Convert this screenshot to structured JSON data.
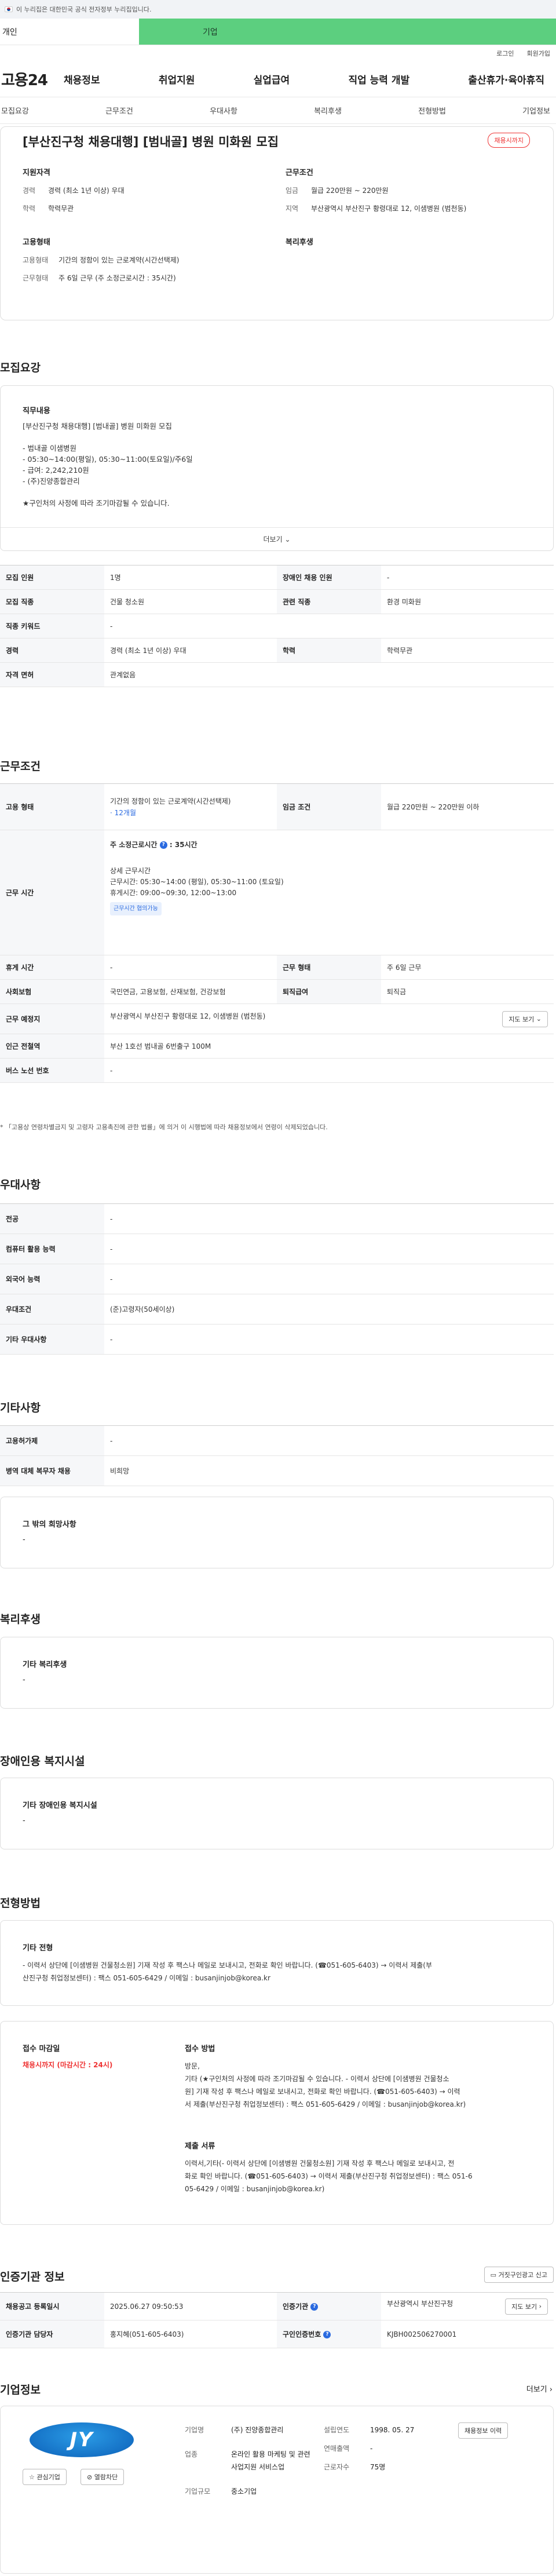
{
  "gov_notice": "이 누리집은 대한민국 공식 전자정부 누리집입니다.",
  "tabs": {
    "personal": "개인",
    "company": "기업"
  },
  "util": {
    "login": "로그인",
    "join": "회원가입"
  },
  "logo": "고용24",
  "gnb": [
    "채용정보",
    "취업지원",
    "실업급여",
    "직업 능력 개발",
    "출산휴가·육아휴직"
  ],
  "subnav": [
    "모집요강",
    "근무조건",
    "우대사항",
    "복리후생",
    "전형방법",
    "기업정보"
  ],
  "job": {
    "title": "[부산진구청 채용대행] [범내골] 병원 미화원 모집",
    "badge": "채용시까지",
    "applicant_title": "지원자격",
    "career_label": "경력",
    "career_value": "경력 (최소 1년 이상) 우대",
    "edu_label": "학력",
    "edu_value": "학력무관",
    "work_title": "근무조건",
    "wage_label": "임금",
    "wage_value": "월급 220만원 ~ 220만원",
    "region_label": "지역",
    "region_value": "부산광역시 부산진구 황령대로 12, 이샘병원 (범천동)",
    "emp_title": "고용형태",
    "emp_label": "고용형태",
    "emp_value": "기간의 정함이 있는 근로계약(시간선택제)",
    "hours_label": "근무형태",
    "hours_value": "주 6일 근무 (주 소정근로시간 : 35시간)",
    "welfare_title": "복리후생"
  },
  "recruit": {
    "section_title": "모집요강",
    "duty_title": "직무내용",
    "duty_lines": [
      "[부산진구청 채용대행] [범내골] 병원 미화원 모집",
      "",
      "- 범내골 이샘병원",
      "- 05:30~14:00(평일), 05:30~11:00(토요일)/주6일",
      "- 급여: 2,242,210원",
      "- (주)진양종합관리",
      "",
      "★구인처의 사정에 따라 조기마감될 수 있습니다."
    ],
    "more": "더보기",
    "rows": [
      {
        "k1": "모집 인원",
        "v1": "1명",
        "k2": "장애인 채용 인원",
        "v2": "-"
      },
      {
        "k1": "모집 직종",
        "v1": "건물 청소원",
        "k2": "관련 직종",
        "v2": "환경 미화원"
      },
      {
        "k1": "직종 키워드",
        "v1": "-"
      },
      {
        "k1": "경력",
        "v1": "경력 (최소 1년 이상) 우대",
        "k2": "학력",
        "v2": "학력무관"
      },
      {
        "k1": "자격 면허",
        "v1": "관계없음"
      }
    ]
  },
  "condition": {
    "section_title": "근무조건",
    "emp_label": "고용 형태",
    "emp_value": "기간의 정함이 있는 근로계약(시간선택제)",
    "emp_period": "· 12개월",
    "pay_label": "임금 조건",
    "pay_value": "월급 220만원 ~ 220만원 이하",
    "time_label": "근무 시간",
    "weekly": "주 소정근로시간",
    "weekly_hours": "35시간",
    "detail_title": "상세 근무시간",
    "detail_work": "근무시간: 05:30~14:00 (평일), 05:30~11:00 (토요일)",
    "detail_rest": "휴게시간: 09:00~09:30, 12:00~13:00",
    "detail_tag": "근무시간 협의가능",
    "leave_label": "휴게 시간",
    "leave_value": "-",
    "form_label": "근무 형태",
    "form_value": "주 6일 근무",
    "ins_label": "사회보험",
    "ins_value": "국민연금, 고용보험, 산재보험, 건강보험",
    "sev_label": "퇴직급여",
    "sev_value": "퇴직금",
    "place_label": "근무 예정지",
    "place_value": "부산광역시 부산진구 황령대로 12, 이샘병원 (범천동)",
    "map_btn": "지도 보기",
    "subway_label": "인근 전철역",
    "subway_value": "부산 1호선 범내골 6번출구 100M",
    "bus_label": "버스 노선 번호",
    "bus_value": "-",
    "note": "* 「고용상 연령차별금지 및 고령자 고용촉진에 관한 법률」에 의거 이 시행법에 따라 채용정보에서 연령이 삭제되었습니다."
  },
  "pref": {
    "section_title": "우대사항",
    "rows": [
      {
        "k": "전공",
        "v": "-"
      },
      {
        "k": "컴퓨터 활용 능력",
        "v": "-"
      },
      {
        "k": "외국어 능력",
        "v": "-"
      },
      {
        "k": "우대조건",
        "v": "(준)고령자(50세이상)"
      },
      {
        "k": "기타 우대사항",
        "v": "-"
      }
    ]
  },
  "etc": {
    "section_title": "기타사항",
    "rows": [
      {
        "k": "고용허가제",
        "v": "-"
      },
      {
        "k": "병역 대체 복무자 채용",
        "v": "비희망"
      }
    ],
    "other_title": "그 밖의 희망사항",
    "other_value": "-"
  },
  "welfare": {
    "section_title": "복리후생",
    "box_title": "기타 복리후생",
    "box_value": "-"
  },
  "disability": {
    "section_title": "장애인용 복지시설",
    "box_title": "기타 장애인용 복지시설",
    "box_value": "-"
  },
  "selection": {
    "section_title": "전형방법",
    "other_title": "기타 전형",
    "other_line1": "- 이력서 상단에 [이샘병원 건물청소원] 기재 작성 후 팩스나 메일로 보내시고, 전화로 확인 바랍니다. (☎051-605-6403) → 이력서 제출(부",
    "other_line2": "산진구청 취업정보센터) : 팩스 051-605-6429 / 이메일 : busanjinjob@korea.kr",
    "deadline_title": "접수 마감일",
    "deadline_value": "채용시까지 (마감시간 : 24시)",
    "method_title": "접수 방법",
    "method_lines": [
      "방문,",
      "기타 (★구인처의 사정에 따라 조기마감될 수 있습니다. - 이력서 상단에 [이샘병원 건물청소",
      "원] 기재 작성 후 팩스나 메일로 보내시고, 전화로 확인 바랍니다. (☎051-605-6403) → 이력",
      "서 제출(부산진구청 취업정보센터) : 팩스 051-605-6429 / 이메일 : busanjinjob@korea.kr)"
    ],
    "docs_title": "제출 서류",
    "docs_lines": [
      "이력서,기타(- 이력서 상단에 [이샘병원 건물청소원] 기재 작성 후 팩스나 메일로 보내시고, 전",
      "화로 확인 바랍니다. (☎051-605-6403) → 이력서 제출(부산진구청 취업정보센터) : 팩스 051-6",
      "05-6429 / 이메일 : busanjinjob@korea.kr)"
    ]
  },
  "agency": {
    "section_title": "인증기관 정보",
    "report_btn": "거짓구인광고 신고",
    "reg_label": "채용공고 등록일시",
    "reg_value": "2025.06.27 09:50:53",
    "org_label": "인증기관",
    "org_value": "부산광역시 부산진구청",
    "map_btn": "지도 보기",
    "mgr_label": "인증기관 담당자",
    "mgr_value": "홍지혜(051-605-6403)",
    "no_label": "구인인증번호",
    "no_value": "KJBH002506270001"
  },
  "company": {
    "section_title": "기업정보",
    "more": "더보기",
    "logo_text": "JY",
    "fav_btn": "관심기업",
    "block_btn": "열람차단",
    "name_label": "기업명",
    "name_value": "(주) 진양종합관리",
    "ind_label": "업종",
    "ind_value": "온라인 활용 마케팅 및 관련 사업지원 서비스업",
    "size_label": "기업규모",
    "size_value": "중소기업",
    "est_label": "설립연도",
    "est_value": "1998. 05. 27",
    "sales_label": "연매출액",
    "sales_value": "-",
    "emp_label": "근로자수",
    "emp_value": "75명",
    "jobs_btn": "채용정보 이력"
  },
  "colors": {
    "brand_green": "#5ccf7f",
    "accent_red": "#ee3333",
    "accent_blue": "#2a6ae0"
  }
}
